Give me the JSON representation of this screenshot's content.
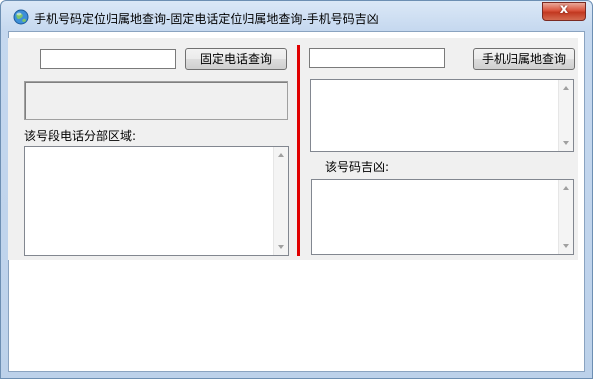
{
  "window": {
    "title": "手机号码定位归属地查询-固定电话定位归属地查询-手机号码吉凶",
    "close_glyph": "x",
    "app_icon": "globe-icon"
  },
  "left": {
    "query_input_value": "",
    "query_button_label": "固定电话查询",
    "result_value": "",
    "distribution_label": "该号段电话分部区域:",
    "distribution_text": ""
  },
  "right": {
    "query_input_value": "",
    "query_button_label": "手机归属地查询",
    "result_text": "",
    "fortune_label": "该号码吉凶:",
    "fortune_text": ""
  },
  "colors": {
    "divider": "#e00000",
    "close_button": "#c23820"
  }
}
